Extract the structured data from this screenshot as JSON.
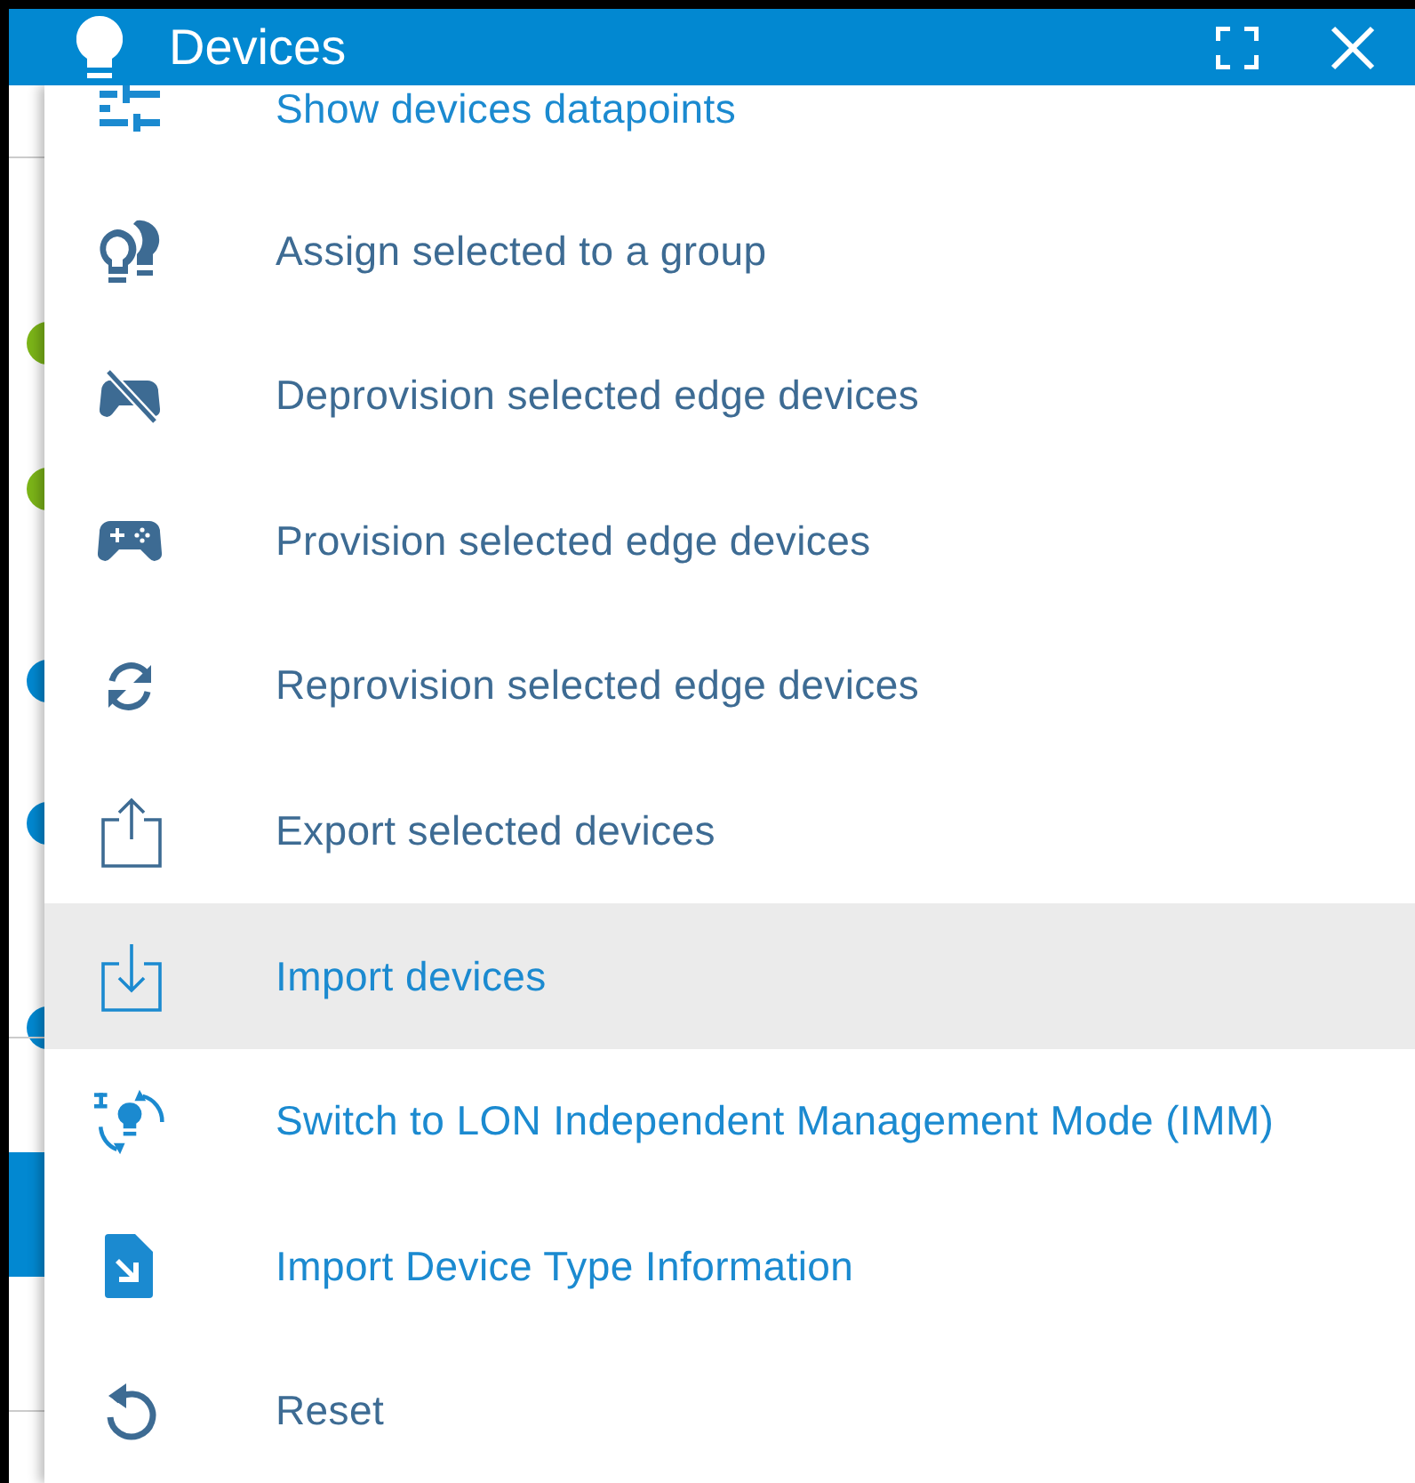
{
  "window": {
    "title": "Devices"
  },
  "menu": {
    "items": [
      {
        "label": "Show devices datapoints",
        "kind": "accent",
        "selected": false
      },
      {
        "label": "Assign selected to a group",
        "kind": "normal",
        "selected": false
      },
      {
        "label": "Deprovision selected edge devices",
        "kind": "normal",
        "selected": false
      },
      {
        "label": "Provision selected edge devices",
        "kind": "normal",
        "selected": false
      },
      {
        "label": "Reprovision selected edge devices",
        "kind": "normal",
        "selected": false
      },
      {
        "label": "Export selected devices",
        "kind": "normal",
        "selected": false
      },
      {
        "label": "Import devices",
        "kind": "accent",
        "selected": true
      },
      {
        "label": "Switch to LON Independent Management Mode (IMM)",
        "kind": "accent",
        "selected": false
      },
      {
        "label": "Import Device Type Information",
        "kind": "accent",
        "selected": false
      },
      {
        "label": "Reset",
        "kind": "normal",
        "selected": false
      }
    ]
  }
}
